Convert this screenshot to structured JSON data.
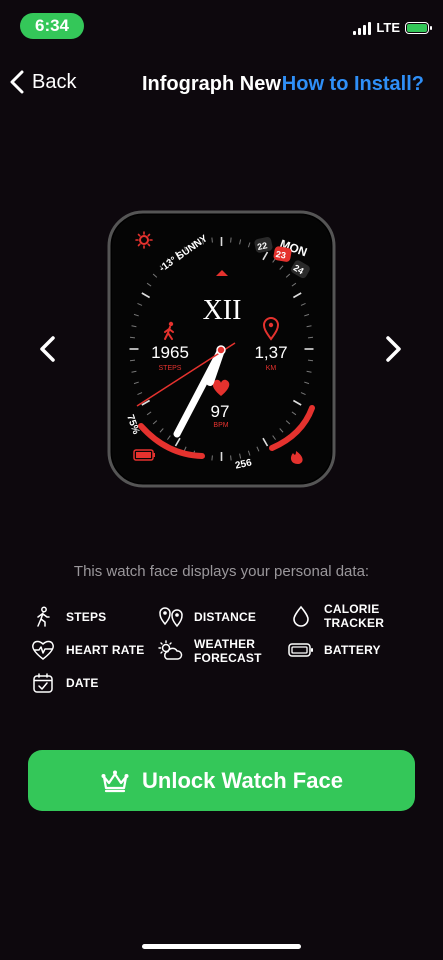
{
  "status_bar": {
    "time": "6:34",
    "network": "LTE",
    "battery_color": "#34c759"
  },
  "nav": {
    "back_label": "Back",
    "title": "Infograph New",
    "install_link": "How to Install?"
  },
  "watch_face": {
    "weather": "-13° SUNNY",
    "day": "MON",
    "dates": [
      "22",
      "23",
      "24"
    ],
    "hour_numeral": "XII",
    "steps_value": "1965",
    "steps_label": "STEPS",
    "distance_value": "1,37",
    "distance_label": "KM",
    "heart_value": "97",
    "heart_label": "BPM",
    "battery_percent": "75%",
    "calories": "256",
    "accent_color": "#e5322e"
  },
  "info_text": "This watch face displays your personal data:",
  "features": [
    {
      "label": "STEPS",
      "icon": "walking-icon"
    },
    {
      "label": "DISTANCE",
      "icon": "location-pin-icon"
    },
    {
      "label": "CALORIE\nTRACKER",
      "icon": "drop-icon"
    },
    {
      "label": "HEART RATE",
      "icon": "heart-rate-icon"
    },
    {
      "label": "WEATHER\nFORECAST",
      "icon": "weather-icon"
    },
    {
      "label": "BATTERY",
      "icon": "battery-icon"
    },
    {
      "label": "DATE",
      "icon": "calendar-icon"
    }
  ],
  "unlock_button": {
    "label": "Unlock Watch Face",
    "color": "#34c759"
  }
}
